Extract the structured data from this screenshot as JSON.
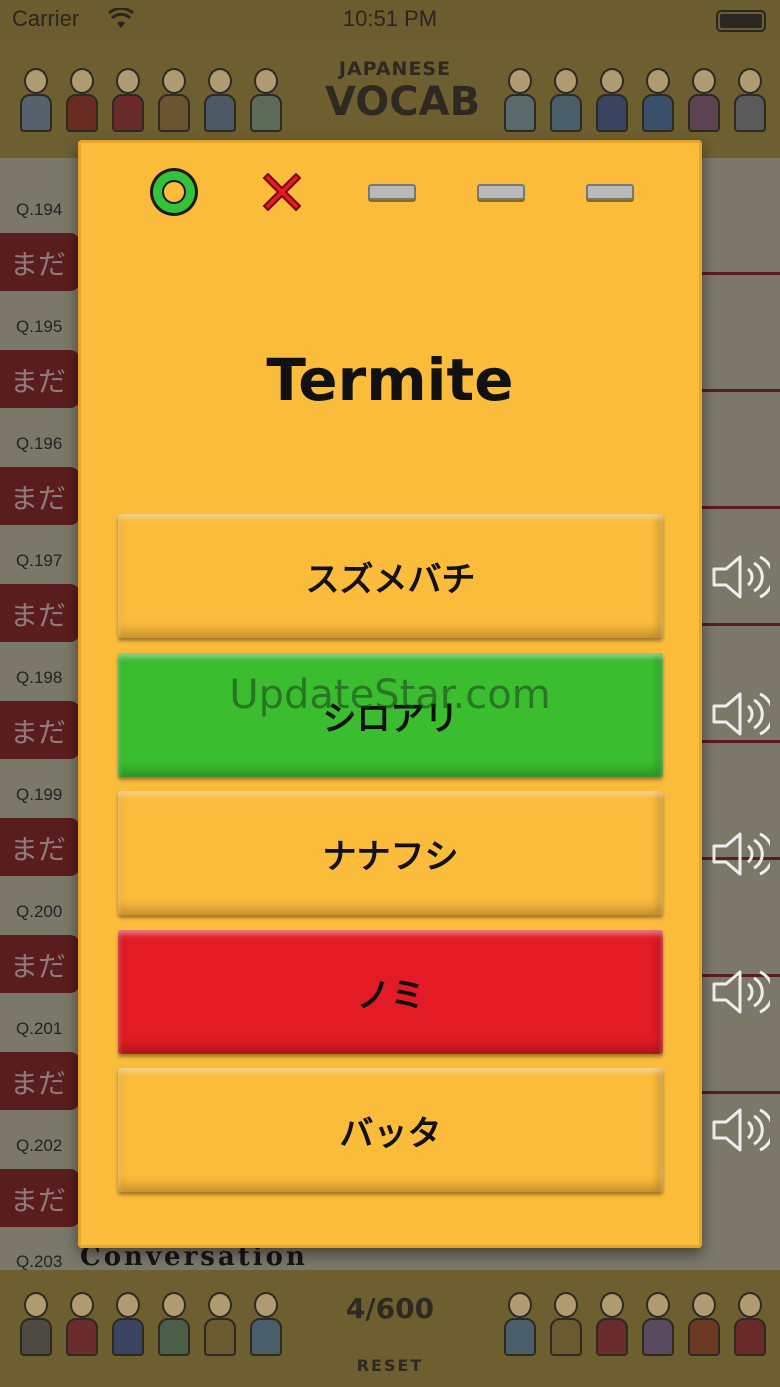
{
  "status_bar": {
    "carrier": "Carrier",
    "time": "10:51 PM"
  },
  "header": {
    "logo_line1": "JAPANESE",
    "logo_line2": "VOCAB"
  },
  "list": {
    "rows": [
      {
        "q": "Q.194",
        "status": "まだ"
      },
      {
        "q": "Q.195",
        "status": "まだ"
      },
      {
        "q": "Q.196",
        "status": "まだ"
      },
      {
        "q": "Q.197",
        "status": "まだ"
      },
      {
        "q": "Q.198",
        "status": "まだ"
      },
      {
        "q": "Q.199",
        "status": "まだ"
      },
      {
        "q": "Q.200",
        "status": "まだ"
      },
      {
        "q": "Q.201",
        "status": "まだ"
      },
      {
        "q": "Q.202",
        "status": "まだ"
      }
    ],
    "last_q": "Q.203",
    "category": "Conversation"
  },
  "footer": {
    "progress": "4/600",
    "reset": "RESET"
  },
  "quiz": {
    "marks": [
      "correct-circle",
      "wrong-x",
      "empty",
      "empty",
      "empty"
    ],
    "word": "Termite",
    "options": [
      {
        "label": "スズメバチ",
        "state": "normal",
        "color": "#fbbb3b"
      },
      {
        "label": "シロアリ",
        "state": "correct",
        "color": "#3bbd30"
      },
      {
        "label": "ナナフシ",
        "state": "normal",
        "color": "#fbbb3b"
      },
      {
        "label": "ノミ",
        "state": "wrong",
        "color": "#e21b24"
      },
      {
        "label": "バッタ",
        "state": "normal",
        "color": "#fbbb3b"
      }
    ]
  },
  "watermark": "UpdateStar.com",
  "colors": {
    "modal": "#fbbb3b",
    "correct": "#3bbd30",
    "wrong": "#e21b24",
    "dimmed_red": "#5a1d1d"
  }
}
